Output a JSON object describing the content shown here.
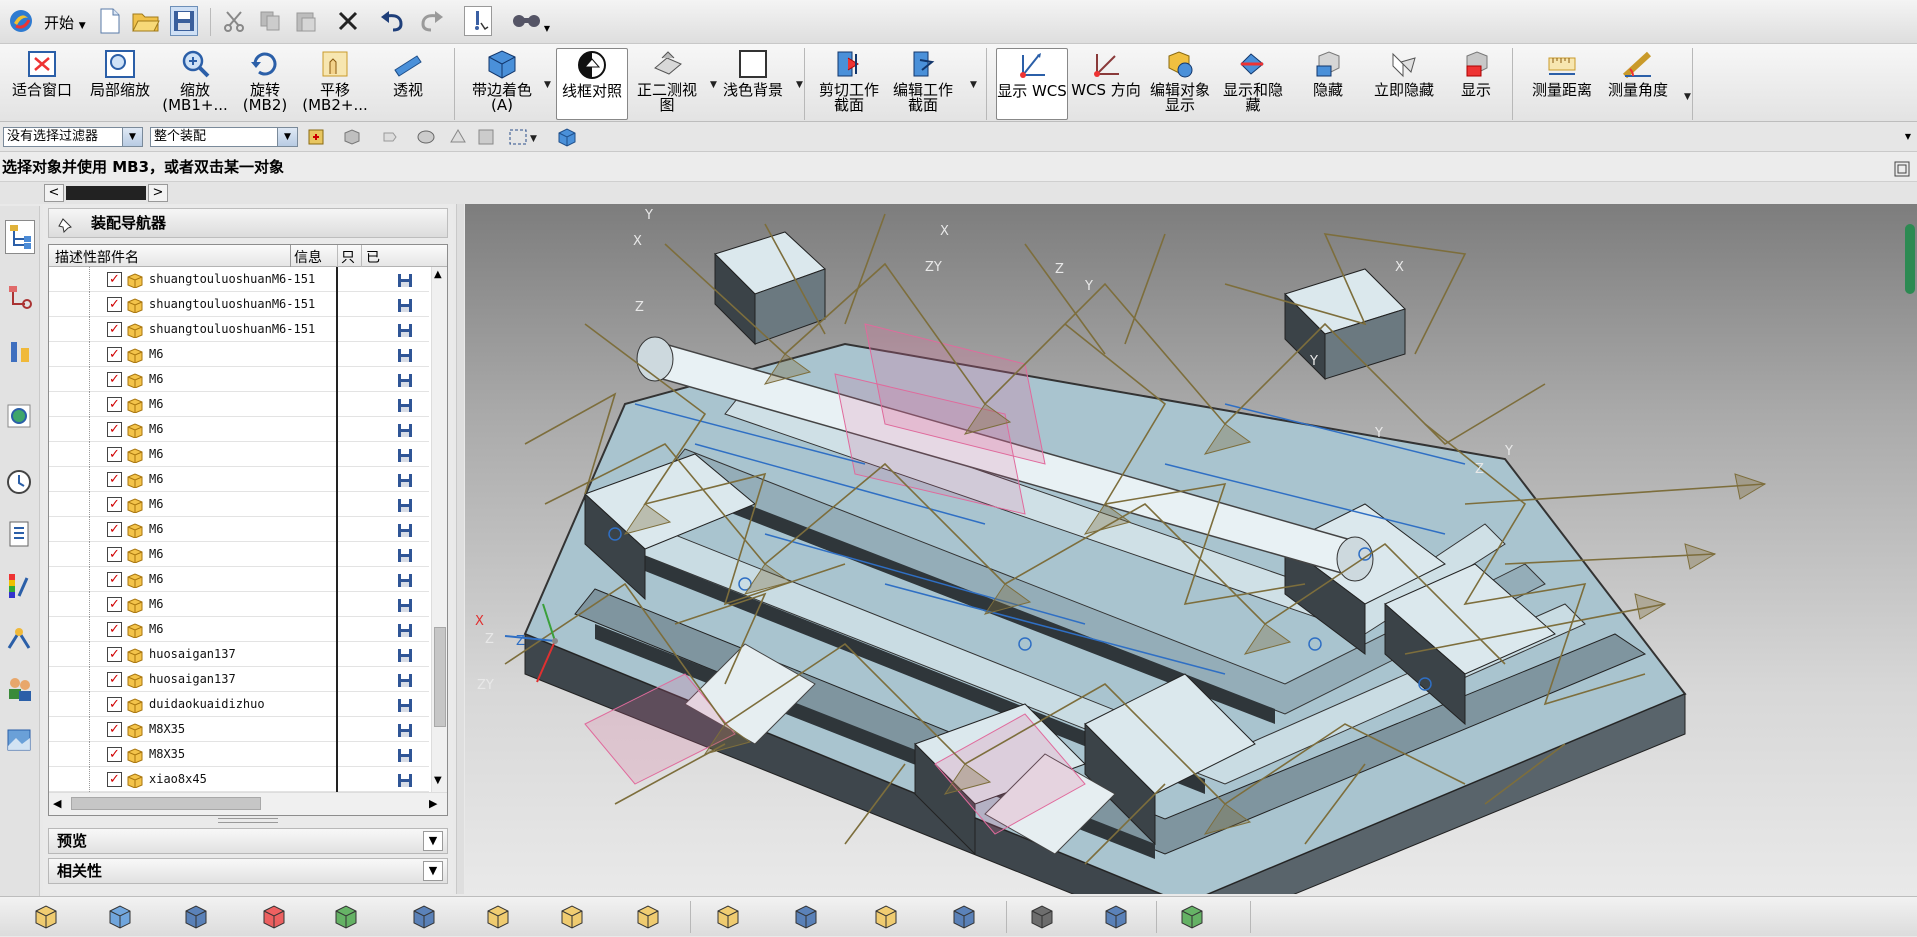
{
  "quick_access": {
    "start_label": "开始",
    "icons": [
      "app-logo-icon",
      "new-file-icon",
      "open-folder-icon",
      "save-icon",
      "cut-icon",
      "copy-icon",
      "paste-icon",
      "delete-icon",
      "undo-icon",
      "redo-icon",
      "info-icon",
      "touch-mode-icon"
    ]
  },
  "ribbon": {
    "buttons": [
      {
        "label": "适合窗口",
        "icon": "fit-window-icon"
      },
      {
        "label": "局部缩放",
        "icon": "zoom-area-icon"
      },
      {
        "label": "缩放\n(MB1+...",
        "icon": "zoom-icon"
      },
      {
        "label": "旋转\n(MB2)",
        "icon": "rotate-icon"
      },
      {
        "label": "平移\n(MB2+...",
        "icon": "pan-icon"
      },
      {
        "label": "透视",
        "icon": "perspective-icon"
      },
      {
        "label": "带边着色\n(A)",
        "icon": "shaded-edges-icon"
      },
      {
        "label": "线框对照",
        "icon": "wireframe-icon"
      },
      {
        "label": "正二测视\n图",
        "icon": "dimetric-view-icon"
      },
      {
        "label": "浅色背景",
        "icon": "light-background-icon"
      },
      {
        "label": "剪切工作\n截面",
        "icon": "clip-section-icon"
      },
      {
        "label": "编辑工作\n截面",
        "icon": "edit-section-icon"
      },
      {
        "label": "显示 WCS",
        "icon": "show-wcs-icon"
      },
      {
        "label": "WCS 方向",
        "icon": "wcs-orient-icon"
      },
      {
        "label": "编辑对象\n显示",
        "icon": "edit-object-display-icon"
      },
      {
        "label": "显示和隐\n藏",
        "icon": "show-hide-icon"
      },
      {
        "label": "隐藏",
        "icon": "hide-icon"
      },
      {
        "label": "立即隐藏",
        "icon": "immediate-hide-icon"
      },
      {
        "label": "显示",
        "icon": "show-icon"
      },
      {
        "label": "测量距离",
        "icon": "measure-distance-icon"
      },
      {
        "label": "测量角度",
        "icon": "measure-angle-icon"
      }
    ]
  },
  "filter_bar": {
    "type_filter": "没有选择过滤器",
    "scope_filter": "整个装配"
  },
  "cue_line": "选择对象并使用 MB3，或者双击某一对象",
  "navigator": {
    "title": "装配导航器",
    "columns": {
      "name": "描述性部件名",
      "info": "信息",
      "readonly": "只",
      "modified": "已"
    },
    "rows": [
      {
        "name": "shuangtouluoshuanM6-151"
      },
      {
        "name": "shuangtouluoshuanM6-151"
      },
      {
        "name": "shuangtouluoshuanM6-151"
      },
      {
        "name": "M6"
      },
      {
        "name": "M6"
      },
      {
        "name": "M6"
      },
      {
        "name": "M6"
      },
      {
        "name": "M6"
      },
      {
        "name": "M6"
      },
      {
        "name": "M6"
      },
      {
        "name": "M6"
      },
      {
        "name": "M6"
      },
      {
        "name": "M6"
      },
      {
        "name": "M6"
      },
      {
        "name": "M6"
      },
      {
        "name": "huosaigan137"
      },
      {
        "name": "huosaigan137"
      },
      {
        "name": "duidaokuaidizhuo"
      },
      {
        "name": "M8X35"
      },
      {
        "name": "M8X35"
      },
      {
        "name": "xiao8x45"
      }
    ],
    "preview_label": "预览",
    "dependencies_label": "相关性"
  },
  "viewport": {
    "axis_labels": [
      "Z",
      "X"
    ],
    "csys_labels": [
      "Z",
      "ZY",
      "Y",
      "X",
      "Z",
      "ZY",
      "X",
      "Y",
      "Z",
      "Y",
      "X",
      "Y",
      "Z",
      "Y"
    ]
  },
  "colors": {
    "accent": "#2f6fc4",
    "check_red": "#d00000",
    "pink": "#e06a9c",
    "olive": "#7d6e3c"
  }
}
